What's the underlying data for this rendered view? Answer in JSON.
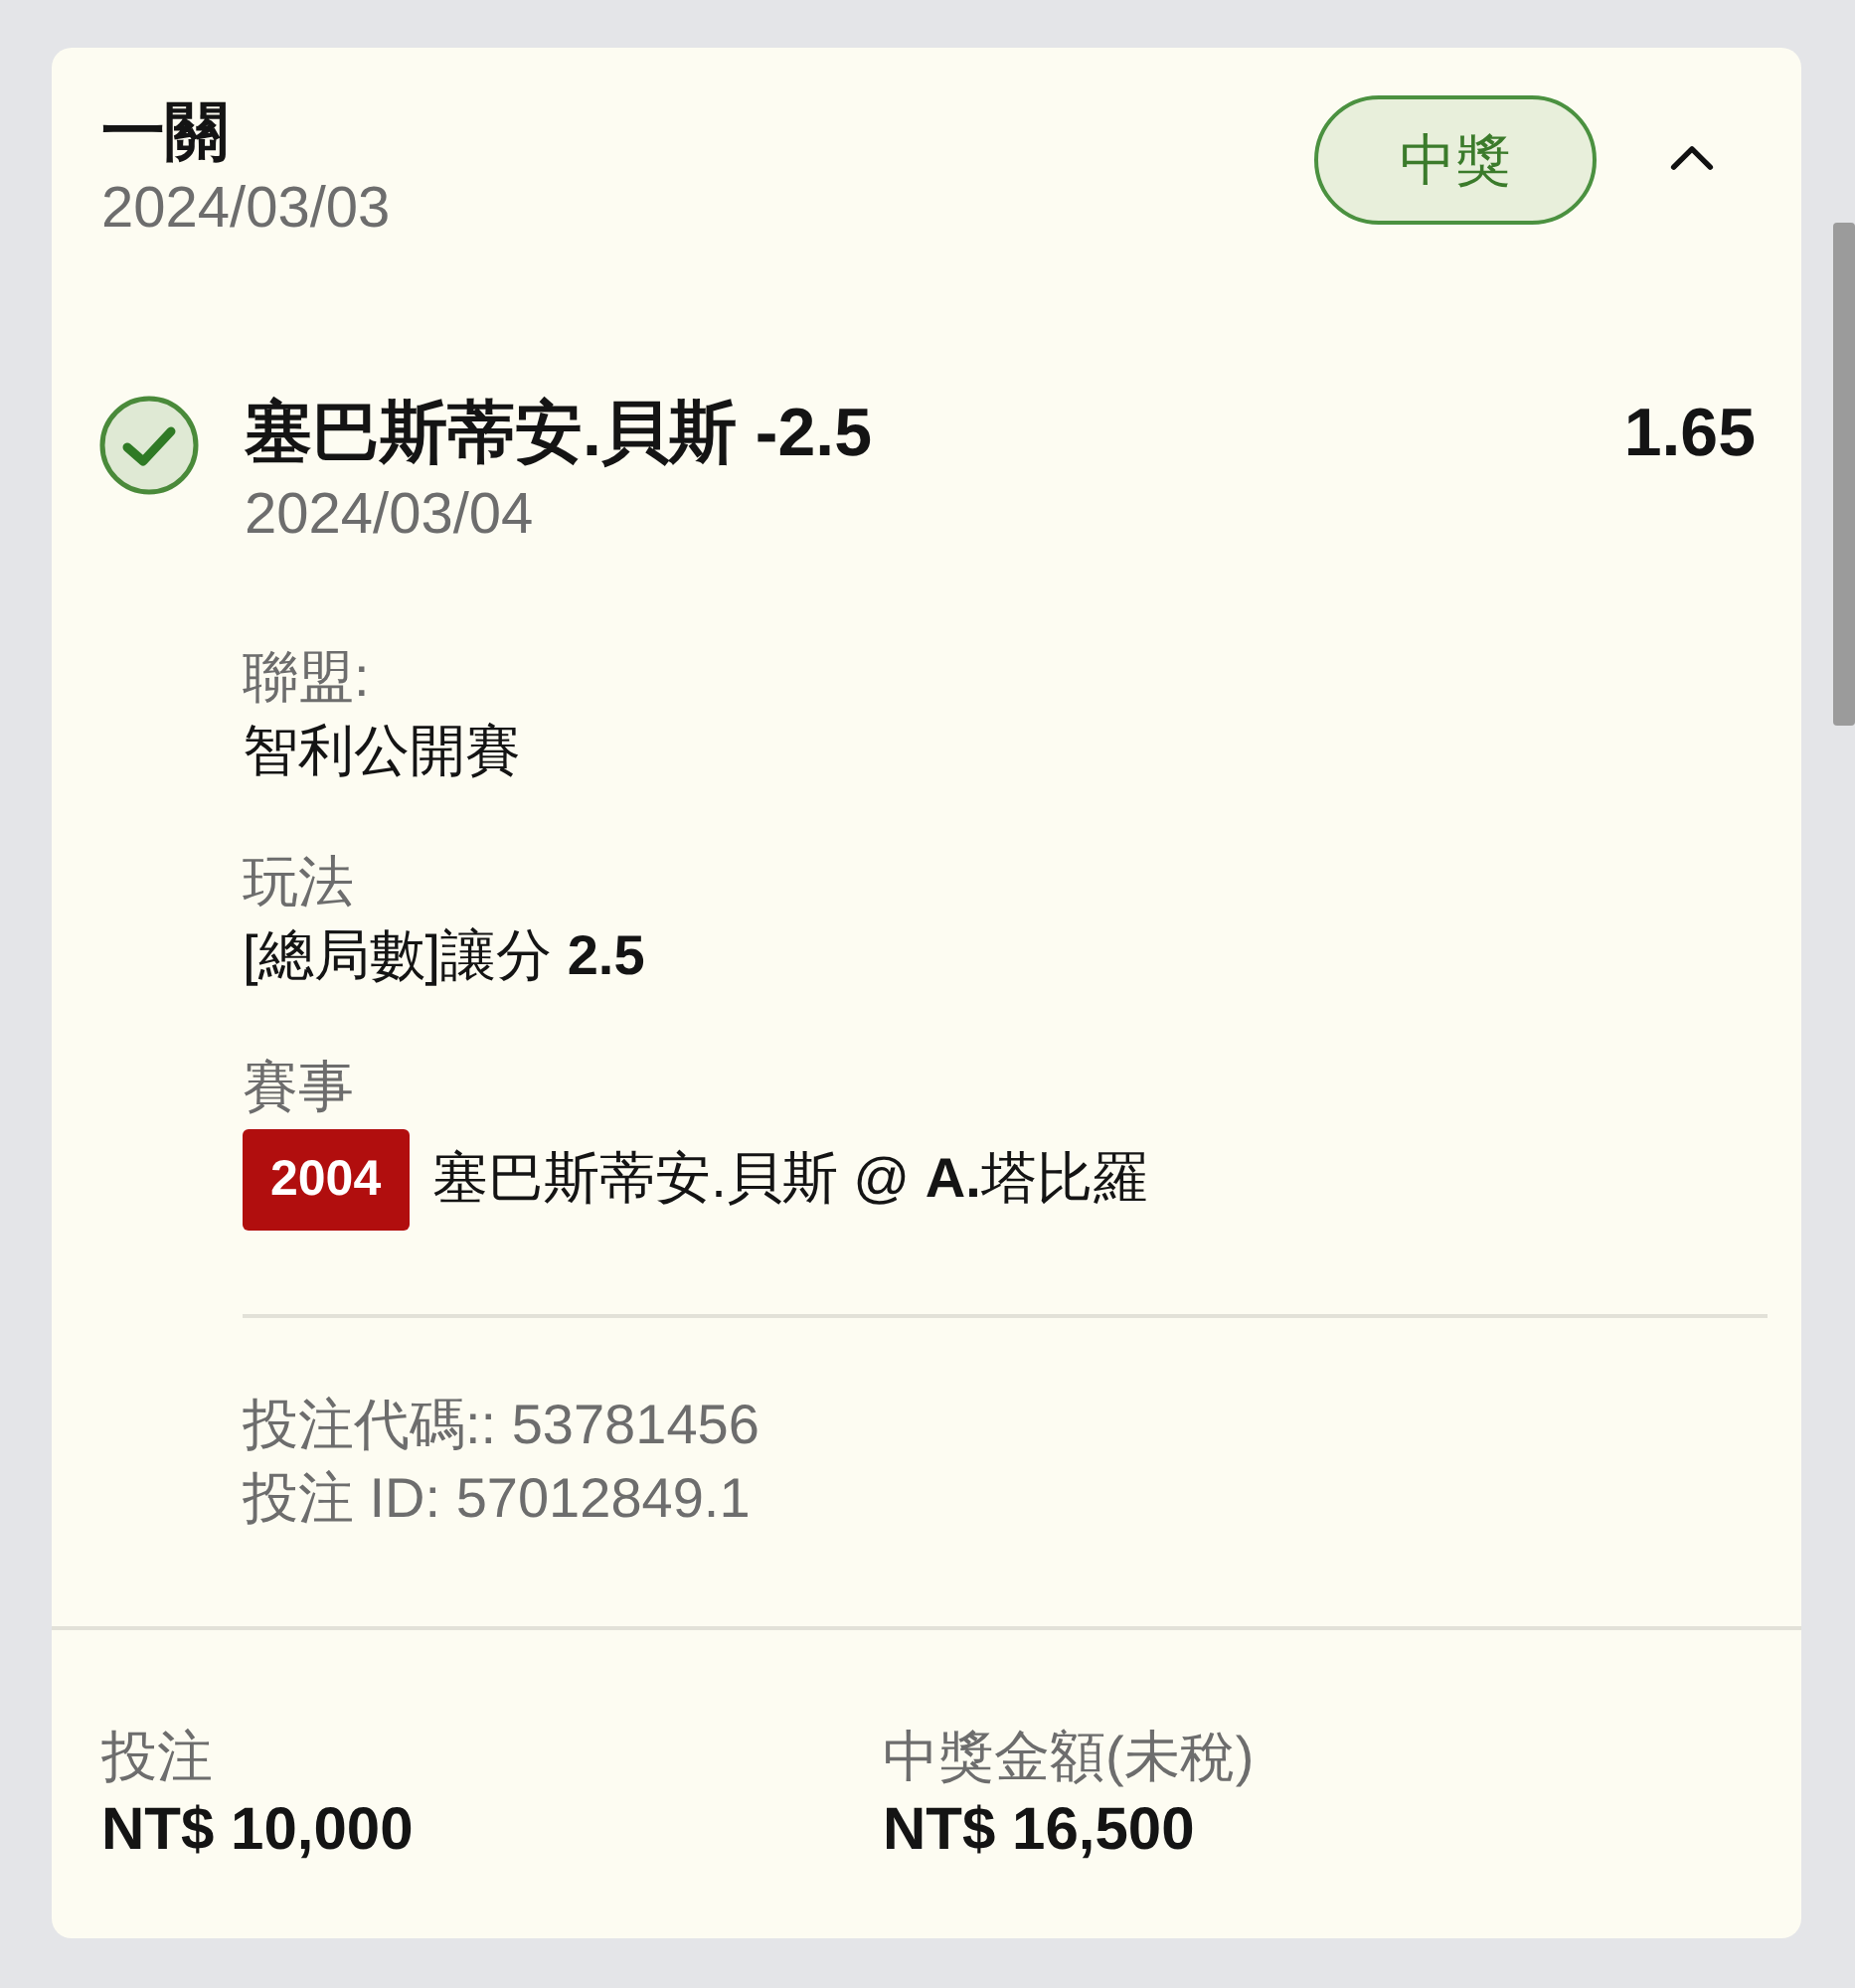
{
  "card": {
    "title": "一關",
    "date": "2024/03/03",
    "status": {
      "label": "中獎",
      "kind": "won"
    },
    "expanded": true
  },
  "selection": {
    "won": true,
    "name": "塞巴斯蒂安.貝斯 -2.5",
    "odds": "1.65",
    "date": "2024/03/04"
  },
  "fields": [
    {
      "label": "聯盟:",
      "value": "智利公開賽"
    },
    {
      "label": "玩法",
      "value": "[總局數]讓分 **2.5**"
    },
    {
      "label": "賽事",
      "tag": "2004",
      "value": "塞巴斯蒂安.貝斯 @ **A.**塔比羅"
    }
  ],
  "bet_codes": [
    "投注代碼:: 53781456",
    "投注 ID: 57012849.1"
  ],
  "summary": [
    {
      "label": "投注",
      "value": "NT$ 10,000"
    },
    {
      "label": "中獎金額(未稅)",
      "value": "NT$ 16,500"
    }
  ]
}
